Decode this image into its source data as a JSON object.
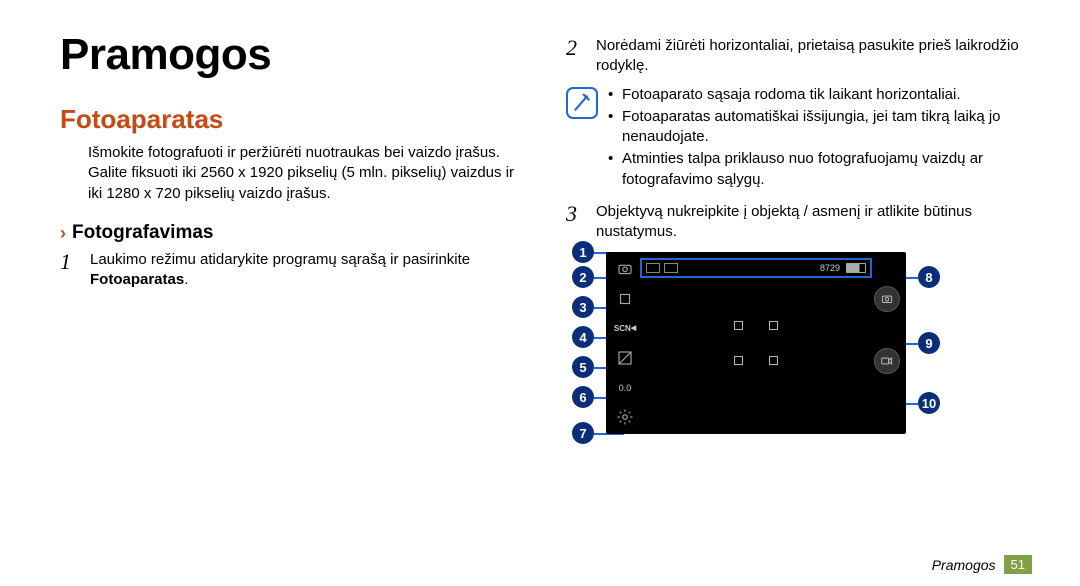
{
  "title": "Pramogos",
  "section": "Fotoaparatas",
  "intro": "Išmokite fotografuoti ir peržiūrėti nuotraukas bei vaizdo įrašus. Galite fiksuoti iki 2560 x 1920 pikselių (5 mln. pikselių) vaizdus ir iki 1280 x 720 pikselių vaizdo įrašus.",
  "subsection": "Fotografavimas",
  "chevron": "›",
  "step1": {
    "num": "1",
    "text_a": "Laukimo režimu atidarykite programų sąrašą ir pasirinkite ",
    "text_b": "Fotoaparatas",
    "text_c": "."
  },
  "step2": {
    "num": "2",
    "text": "Norėdami žiūrėti horizontaliai, prietaisą pasukite prieš laikrodžio rodyklę."
  },
  "notes": [
    "Fotoaparato sąsaja rodoma tik laikant horizontaliai.",
    "Fotoaparatas automatiškai išsijungia, jei tam tikrą laiką jo nenaudojate.",
    "Atminties talpa priklauso nuo fotografuojamų vaizdų ar fotografavimo sąlygų."
  ],
  "step3": {
    "num": "3",
    "text": "Objektyvą nukreipkite į objektą / asmenį ir atlikite būtinus nustatymus."
  },
  "camera": {
    "counter": "8729",
    "leftIcons": [
      "switch",
      "single",
      "scn",
      "ev",
      "ev00",
      "gear"
    ],
    "evLabel": "0.0",
    "scnLabel": "SCN"
  },
  "callouts": {
    "left": [
      "1",
      "2",
      "3",
      "4",
      "5",
      "6",
      "7"
    ],
    "right": [
      "8",
      "9",
      "10"
    ]
  },
  "footer": {
    "label": "Pramogos",
    "page": "51"
  }
}
